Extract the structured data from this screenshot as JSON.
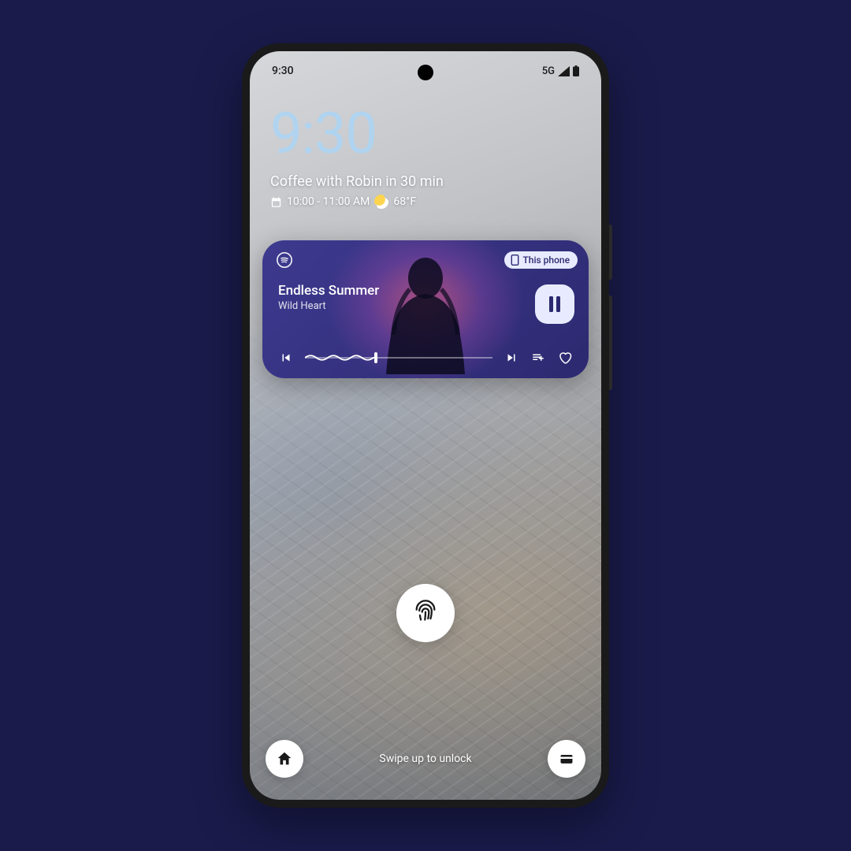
{
  "status": {
    "time": "9:30",
    "network": "5G"
  },
  "clock": "9:30",
  "event": {
    "title": "Coffee with Robin in 30 min",
    "time_range": "10:00 - 11:00 AM",
    "temp": "68°F"
  },
  "media": {
    "device_label": "This phone",
    "track": "Endless Summer",
    "artist": "Wild Heart",
    "progress_pct": 38,
    "icons": {
      "source": "spotify-icon",
      "prev": "skip-previous-icon",
      "next": "skip-next-icon",
      "queue": "playlist-add-icon",
      "like": "heart-icon",
      "playpause": "pause-icon"
    }
  },
  "bottom": {
    "unlock_text": "Swipe up to unlock",
    "left_icon": "home-icon",
    "right_icon": "wallet-icon"
  },
  "colors": {
    "page_bg": "#1a1b4b",
    "clock": "#b0d4f0",
    "card_bg": "#2d2970",
    "chip_bg": "#e8ebff"
  }
}
